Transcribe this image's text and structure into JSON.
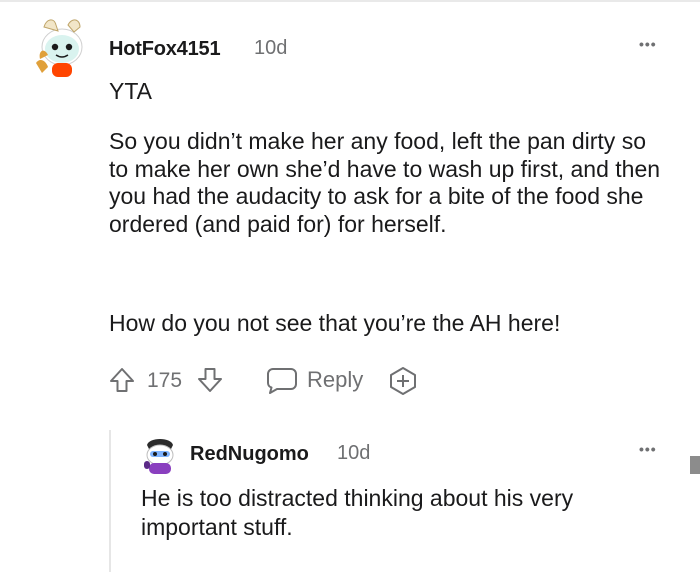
{
  "comment": {
    "username": "HotFox4151",
    "time": "10d",
    "more": "•••",
    "verdict": "YTA",
    "paragraph1": "So you didn’t make her any food, left the pan dirty so to make her own she’d have to wash up first, and then you had the audacity to ask for a bite of the food she ordered (and paid for) for herself.",
    "paragraph2": "How do you not see that you’re the AH here!",
    "votes": "175",
    "reply_label": "Reply"
  },
  "reply": {
    "username": "RedNugomo",
    "time": "10d",
    "more": "•••",
    "text": "He is too distracted thinking about his very important stuff."
  },
  "icons": {
    "upvote": "upvote-arrow-icon",
    "downvote": "downvote-arrow-icon",
    "reply": "speech-bubble-icon",
    "award": "award-plus-icon",
    "more": "more-dots-icon"
  },
  "colors": {
    "text": "#1a1a1b",
    "meta": "#6f7072",
    "line": "#e6e6e6",
    "avatar_bg": "#d9f3ef",
    "avatar_accent": "#ff4500"
  }
}
